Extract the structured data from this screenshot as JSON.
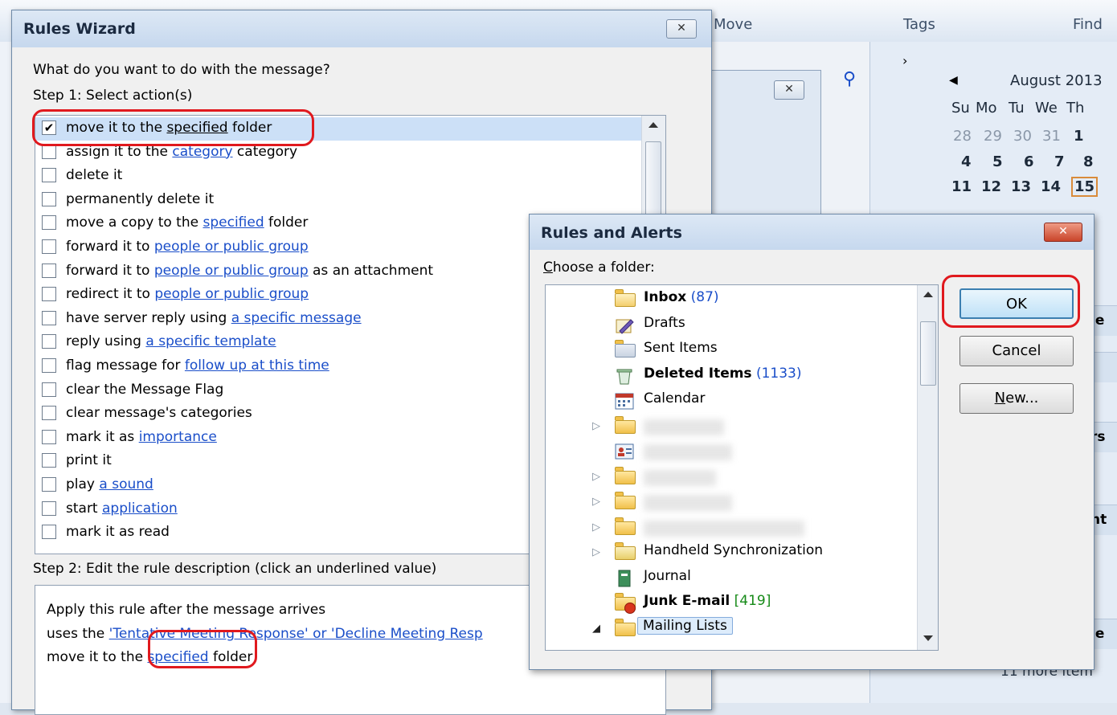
{
  "background": {
    "ribbon": {
      "move_label": "Move",
      "tags_label": "Tags",
      "find_label": "Find"
    },
    "calendar": {
      "month": "August 2013",
      "weekdays": [
        "Su",
        "Mo",
        "Tu",
        "We",
        "Th"
      ],
      "rows": [
        [
          "28",
          "29",
          "30",
          "31",
          "1"
        ],
        [
          "4",
          "5",
          "6",
          "7",
          "8"
        ],
        [
          "11",
          "12",
          "13",
          "14",
          "15"
        ]
      ]
    },
    "more_items": "11 more item"
  },
  "wizard": {
    "title": "Rules Wizard",
    "close_glyph": "✕",
    "question": "What do you want to do with the message?",
    "step1": "Step 1: Select action(s)",
    "actions": [
      {
        "pre": "move it to the ",
        "link": "specified",
        "post": " folder",
        "checked": true
      },
      {
        "pre": "assign it to the ",
        "link": "category",
        "post": " category",
        "checked": false
      },
      {
        "pre": "delete it",
        "link": "",
        "post": "",
        "checked": false
      },
      {
        "pre": "permanently delete it",
        "link": "",
        "post": "",
        "checked": false
      },
      {
        "pre": "move a copy to the ",
        "link": "specified",
        "post": " folder",
        "checked": false
      },
      {
        "pre": "forward it to ",
        "link": "people or public group",
        "post": "",
        "checked": false
      },
      {
        "pre": "forward it to ",
        "link": "people or public group",
        "post": " as an attachment",
        "checked": false
      },
      {
        "pre": "redirect it to ",
        "link": "people or public group",
        "post": "",
        "checked": false
      },
      {
        "pre": "have server reply using ",
        "link": "a specific message",
        "post": "",
        "checked": false
      },
      {
        "pre": "reply using ",
        "link": "a specific template",
        "post": "",
        "checked": false
      },
      {
        "pre": "flag message for ",
        "link": "follow up at this time",
        "post": "",
        "checked": false
      },
      {
        "pre": "clear the Message Flag",
        "link": "",
        "post": "",
        "checked": false
      },
      {
        "pre": "clear message's categories",
        "link": "",
        "post": "",
        "checked": false
      },
      {
        "pre": "mark it as ",
        "link": "importance",
        "post": "",
        "checked": false
      },
      {
        "pre": "print it",
        "link": "",
        "post": "",
        "checked": false
      },
      {
        "pre": "play ",
        "link": "a sound",
        "post": "",
        "checked": false
      },
      {
        "pre": "start ",
        "link": "application",
        "post": "",
        "checked": false
      },
      {
        "pre": "mark it as read",
        "link": "",
        "post": "",
        "checked": false
      }
    ],
    "step2": "Step 2: Edit the rule description (click an underlined value)",
    "description": {
      "line1": "Apply this rule after the message arrives",
      "line2_pre": "uses the ",
      "line2_link": "'Tentative Meeting Response' or 'Decline Meeting Resp",
      "line3_pre": "move it to the ",
      "line3_link": "specified",
      "line3_post": " folder"
    }
  },
  "alerts": {
    "title": "Rules and Alerts",
    "close_glyph": "✕",
    "choose_label": "Choose a folder:",
    "folders": [
      {
        "label": "Inbox",
        "count": "(87)",
        "count_color": "blue",
        "bold": true,
        "arrow": "",
        "icon": "inbox-folder-icon"
      },
      {
        "label": "Drafts",
        "count": "",
        "count_color": "",
        "bold": false,
        "arrow": "",
        "icon": "drafts-icon"
      },
      {
        "label": "Sent Items",
        "count": "",
        "count_color": "",
        "bold": false,
        "arrow": "",
        "icon": "sent-items-icon"
      },
      {
        "label": "Deleted Items",
        "count": "(1133)",
        "count_color": "blue",
        "bold": true,
        "arrow": "",
        "icon": "deleted-items-icon"
      },
      {
        "label": "Calendar",
        "count": "",
        "count_color": "",
        "bold": false,
        "arrow": "",
        "icon": "calendar-icon"
      },
      {
        "label": "",
        "count": "",
        "count_color": "",
        "bold": false,
        "arrow": "▷",
        "icon": "folder-icon",
        "blurred": true
      },
      {
        "label": "",
        "count": "",
        "count_color": "",
        "bold": false,
        "arrow": "",
        "icon": "contacts-icon",
        "blurred": true
      },
      {
        "label": "",
        "count": "",
        "count_color": "",
        "bold": false,
        "arrow": "▷",
        "icon": "folder-icon",
        "blurred": true
      },
      {
        "label": "",
        "count": "",
        "count_color": "",
        "bold": false,
        "arrow": "▷",
        "icon": "folder-icon",
        "blurred": true
      },
      {
        "label": "",
        "count": "",
        "count_color": "",
        "bold": false,
        "arrow": "▷",
        "icon": "folder-icon",
        "blurred": true
      },
      {
        "label": "Handheld Synchronization",
        "count": "",
        "count_color": "",
        "bold": false,
        "arrow": "▷",
        "icon": "sync-folder-icon"
      },
      {
        "label": "Journal",
        "count": "",
        "count_color": "",
        "bold": false,
        "arrow": "",
        "icon": "journal-icon"
      },
      {
        "label": "Junk E-mail",
        "count": "[419]",
        "count_color": "green",
        "bold": true,
        "arrow": "",
        "icon": "junk-email-icon"
      },
      {
        "label": "Mailing Lists",
        "count": "",
        "count_color": "",
        "bold": false,
        "arrow": "◢",
        "icon": "folder-icon",
        "selected": true
      }
    ],
    "buttons": {
      "ok": "OK",
      "cancel": "Cancel",
      "new": "New..."
    }
  },
  "colors": {
    "highlight_ring": "#e0191e",
    "link": "#1a4ec9",
    "selection": "#cce0f7"
  }
}
